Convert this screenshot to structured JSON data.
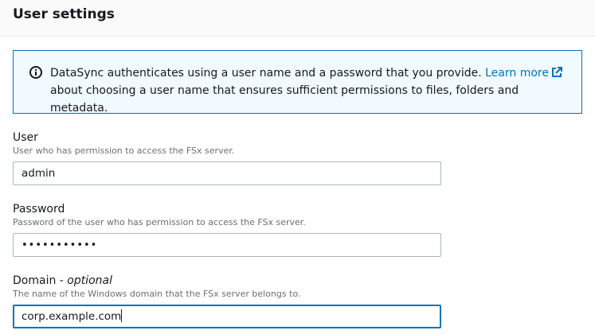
{
  "section": {
    "title": "User settings"
  },
  "info": {
    "text_before": "DataSync authenticates using a user name and a password that you provide. ",
    "link_label": "Learn more",
    "text_after": "about choosing a user name that ensures sufficient permissions to files, folders and metadata.",
    "icon": "info-circle-icon",
    "link_icon": "external-link-icon"
  },
  "fields": {
    "user": {
      "label": "User",
      "description": "User who has permission to access the FSx server.",
      "value": "admin"
    },
    "password": {
      "label": "Password",
      "description": "Password of the user who has permission to access the FSx server.",
      "masked_value": "•••••••••••"
    },
    "domain": {
      "label": "Domain - ",
      "label_optional": "optional",
      "description": "The name of the Windows domain that the FSx server belongs to.",
      "value": "corp.example.com"
    }
  },
  "colors": {
    "accent": "#0073bb",
    "info_bg": "#f1faff",
    "muted_text": "#687078"
  }
}
